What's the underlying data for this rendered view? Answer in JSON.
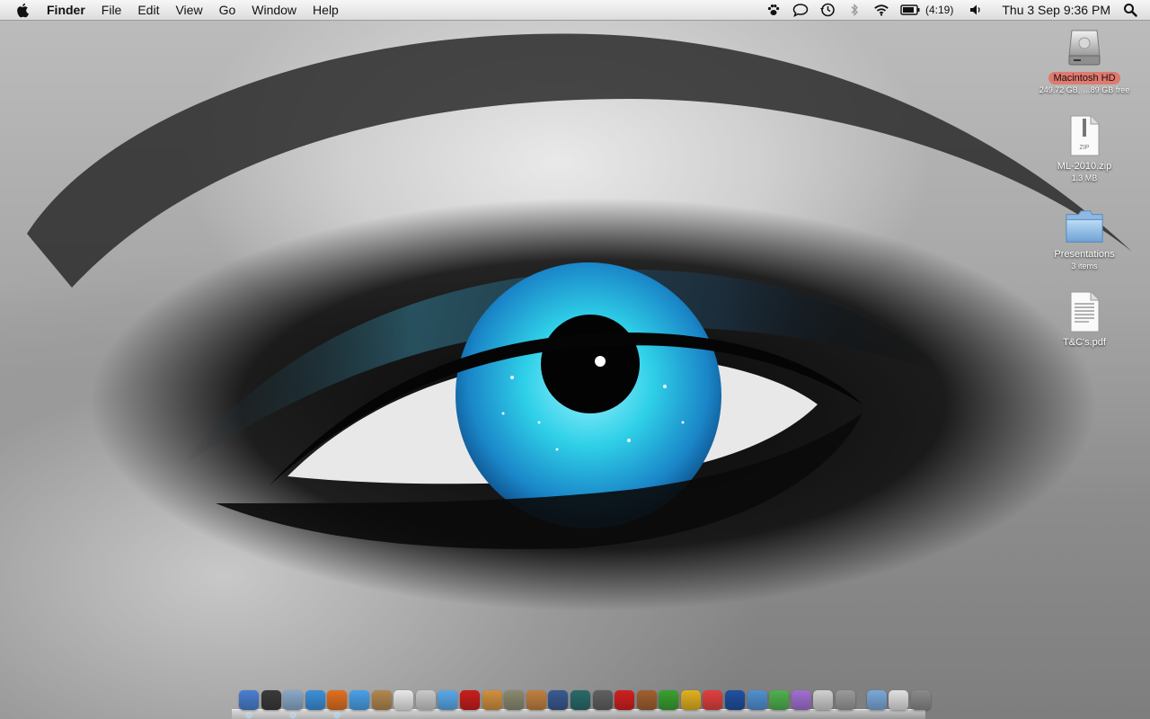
{
  "menubar": {
    "apple_icon": "apple-logo-icon",
    "app_name": "Finder",
    "menus": [
      "File",
      "Edit",
      "View",
      "Go",
      "Window",
      "Help"
    ],
    "status_icons": [
      "paw-icon",
      "speech-bubble-icon",
      "time-machine-icon",
      "bluetooth-icon",
      "wifi-icon",
      "battery-icon",
      "volume-icon"
    ],
    "battery_text": "(4:19)",
    "clock": "Thu 3 Sep  9:36 PM",
    "spotlight_icon": "search-icon"
  },
  "desktop": {
    "icons": [
      {
        "name": "Macintosh HD",
        "sub": "249.72 GB, …89 GB free",
        "icon": "hard-drive-icon",
        "selected": true
      },
      {
        "name": "ML-2010.zip",
        "sub": "1.3 MB",
        "icon": "zip-file-icon",
        "selected": false
      },
      {
        "name": "Presentations",
        "sub": "3 items",
        "icon": "folder-icon",
        "selected": false
      },
      {
        "name": "T&C's.pdf",
        "sub": "",
        "icon": "pdf-document-icon",
        "selected": false
      }
    ],
    "zip_badge": "ZIP"
  },
  "dock": {
    "items": [
      {
        "name": "finder-icon",
        "color": "#4a7fd0",
        "running": true
      },
      {
        "name": "dashboard-icon",
        "color": "#3a3a3a",
        "running": false
      },
      {
        "name": "mail-icon",
        "color": "#8aa9c9",
        "running": true
      },
      {
        "name": "safari-icon",
        "color": "#3d8fd8",
        "running": false
      },
      {
        "name": "firefox-icon",
        "color": "#e07020",
        "running": true
      },
      {
        "name": "ichat-icon",
        "color": "#4aa0e8",
        "running": false
      },
      {
        "name": "address-book-icon",
        "color": "#b08850",
        "running": false
      },
      {
        "name": "ical-icon",
        "color": "#e8e8e8",
        "running": false
      },
      {
        "name": "preview-icon",
        "color": "#c9c9c9",
        "running": false
      },
      {
        "name": "itunes-icon",
        "color": "#5aa8e8",
        "running": false
      },
      {
        "name": "app-red-icon",
        "color": "#c81e1e",
        "running": false
      },
      {
        "name": "iphoto-icon",
        "color": "#d09040",
        "running": false
      },
      {
        "name": "utility-tool-icon",
        "color": "#8a8a70",
        "running": false
      },
      {
        "name": "garageband-icon",
        "color": "#c08040",
        "running": false
      },
      {
        "name": "spaces-icon",
        "color": "#3a5a90",
        "running": false
      },
      {
        "name": "time-machine-icon",
        "color": "#2a6a6a",
        "running": false
      },
      {
        "name": "photo-booth-icon",
        "color": "#606060",
        "running": false
      },
      {
        "name": "games-icon",
        "color": "#d02020",
        "running": false
      },
      {
        "name": "bowl-app-icon",
        "color": "#a06030",
        "running": false
      },
      {
        "name": "spotify-icon",
        "color": "#3aa030",
        "running": false
      },
      {
        "name": "keychain-icon",
        "color": "#e0b020",
        "running": false
      },
      {
        "name": "chrome-app-icon",
        "color": "#e04040",
        "running": false
      },
      {
        "name": "google-earth-icon",
        "color": "#2050a0",
        "running": false
      },
      {
        "name": "network-icon",
        "color": "#5090d0",
        "running": false
      },
      {
        "name": "plant-app-icon",
        "color": "#50b050",
        "running": false
      },
      {
        "name": "purple-app-icon",
        "color": "#a070d0",
        "running": false
      },
      {
        "name": "grid-app-icon",
        "color": "#d0d0d0",
        "running": false
      },
      {
        "name": "system-preferences-icon",
        "color": "#9a9a9a",
        "running": false
      },
      {
        "name": "applications-folder-icon",
        "color": "#7aa8d8",
        "gap": true,
        "running": false
      },
      {
        "name": "documents-stack-icon",
        "color": "#e0e0e0",
        "running": false
      },
      {
        "name": "trash-icon",
        "color": "#8a8a8a",
        "running": false
      }
    ]
  }
}
